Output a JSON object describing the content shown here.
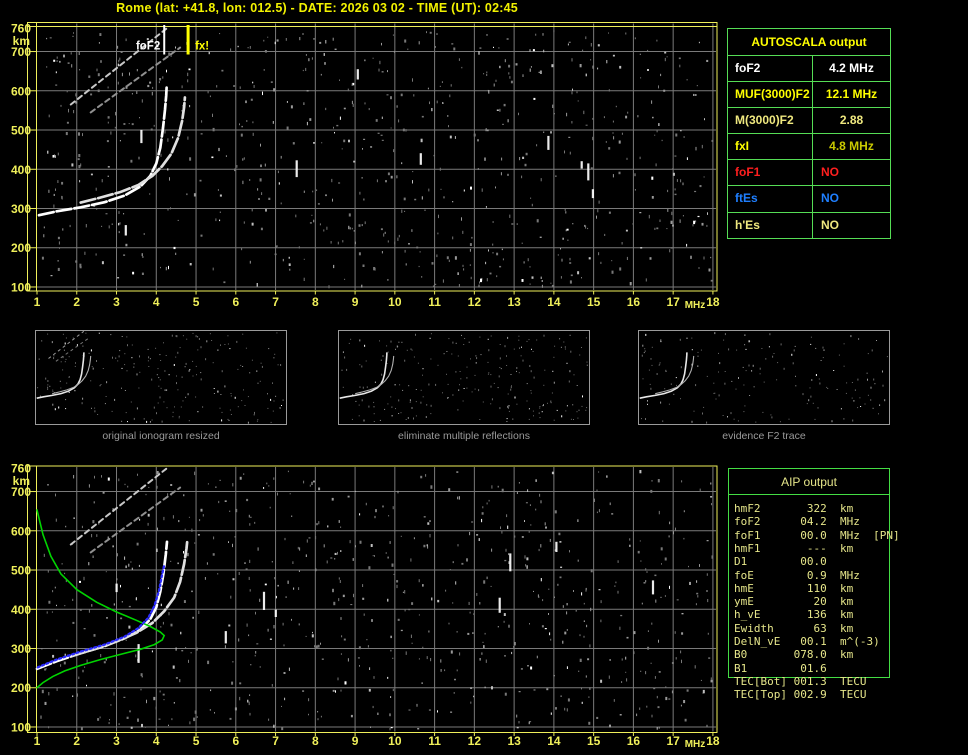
{
  "title": "Rome (lat: +41.8, lon: 012.5) - DATE: 2026 03 02 - TIME (UT): 02:45",
  "colors": {
    "background": "#000000",
    "title_yellow": "#f2f200",
    "axis_yellow": "#efef5a",
    "grid_gray": "#7a7a7a",
    "table_green": "#55dd55",
    "caption_gray": "#9a9a9a",
    "aip_text": "#e6e68a",
    "profile_green": "#00d400",
    "trace_blue": "#2b2bff",
    "marker_foF2": "#ffffff",
    "marker_fxI": "#ffff00"
  },
  "autoscala": {
    "title": "AUTOSCALA output",
    "rows": [
      {
        "label": "foF2",
        "value": "4.2 MHz",
        "color": "#ffffff"
      },
      {
        "label": "MUF(3000)F2",
        "value": "12.1 MHz",
        "color": "#ffff00"
      },
      {
        "label": "M(3000)F2",
        "value": "2.88",
        "color": "#efe87f"
      },
      {
        "label": "fxI",
        "value": "4.8 MHz",
        "color": "#ffff00",
        "value_color": "#c9c900"
      },
      {
        "label": "foF1",
        "value": "NO",
        "color": "#ff1f1f"
      },
      {
        "label": "ftEs",
        "value": "NO",
        "color": "#1f7fff"
      },
      {
        "label": "h'Es",
        "value": "NO",
        "color": "#efe87f"
      }
    ]
  },
  "aip": {
    "title": "AIP output",
    "rows": [
      {
        "label": "hmF2",
        "value": "322",
        "unit": "km"
      },
      {
        "label": "foF2",
        "value": "04.2",
        "unit": "MHz"
      },
      {
        "label": "foF1",
        "value": "00.0",
        "unit": "MHz",
        "extra": "[PN]"
      },
      {
        "label": "hmF1",
        "value": "---",
        "unit": "km"
      },
      {
        "label": "D1",
        "value": "00.0",
        "unit": ""
      },
      {
        "label": "foE",
        "value": "0.9",
        "unit": "MHz"
      },
      {
        "label": "hmE",
        "value": "110",
        "unit": "km"
      },
      {
        "label": "ymE",
        "value": "20",
        "unit": "km"
      },
      {
        "label": "h_vE",
        "value": "136",
        "unit": "km"
      },
      {
        "label": "Ewidth",
        "value": "63",
        "unit": "km"
      },
      {
        "label": "DelN_vE",
        "value": "00.1",
        "unit": "m^(-3)"
      },
      {
        "label": "B0",
        "value": "078.0",
        "unit": "km"
      },
      {
        "label": "B1",
        "value": "01.6",
        "unit": ""
      },
      {
        "label": "TEC[Bot]",
        "value": "001.3",
        "unit": "TECU"
      },
      {
        "label": "TEC[Top]",
        "value": "002.9",
        "unit": "TECU"
      }
    ]
  },
  "thumbnails": [
    {
      "caption": "original ionogram resized"
    },
    {
      "caption": "eliminate multiple reflections"
    },
    {
      "caption": "evidence F2 trace"
    }
  ],
  "noise": {
    "seed": 987654321,
    "plot_dots": 720,
    "plot_streaks": 9,
    "thumb_dots": 240,
    "thumb_dots_sparse": 175
  },
  "chart_data": [
    {
      "type": "scatter",
      "title": "scaled ionogram with autoscaled characteristics",
      "xlabel": "MHz",
      "ylabel": "km",
      "xlim": [
        1,
        18
      ],
      "ylim": [
        100,
        760
      ],
      "grid": true,
      "x_ticks": [
        1,
        2,
        3,
        4,
        5,
        6,
        7,
        8,
        9,
        10,
        11,
        12,
        13,
        14,
        15,
        16,
        17,
        18
      ],
      "y_ticks": [
        760,
        700,
        600,
        500,
        400,
        300,
        200,
        100
      ],
      "annotations": [
        {
          "label": "foF2",
          "x_mhz": 4.2,
          "color": "#ffffff"
        },
        {
          "label": "fx!",
          "x_mhz": 4.8,
          "color": "#ffff00"
        }
      ],
      "series": [
        {
          "name": "F2-trace-ordinary",
          "color": "#ffffff",
          "style": "trace",
          "points": [
            [
              1.05,
              283
            ],
            [
              1.5,
              293
            ],
            [
              2.1,
              303
            ],
            [
              2.7,
              316
            ],
            [
              3.2,
              333
            ],
            [
              3.6,
              356
            ],
            [
              3.85,
              383
            ],
            [
              4.0,
              415
            ],
            [
              4.1,
              455
            ],
            [
              4.17,
              505
            ],
            [
              4.22,
              552
            ],
            [
              4.25,
              588
            ],
            [
              4.26,
              608
            ]
          ]
        },
        {
          "name": "F2-trace-extraordinary",
          "color": "#e0e0e0",
          "style": "trace",
          "points": [
            [
              2.1,
              315
            ],
            [
              2.6,
              328
            ],
            [
              3.1,
              342
            ],
            [
              3.55,
              360
            ],
            [
              3.9,
              383
            ],
            [
              4.15,
              408
            ],
            [
              4.38,
              440
            ],
            [
              4.55,
              480
            ],
            [
              4.65,
              523
            ],
            [
              4.7,
              558
            ],
            [
              4.72,
              583
            ]
          ]
        },
        {
          "name": "second-hop-echo-1",
          "color": "#c8c8c8",
          "style": "dashed",
          "points": [
            [
              1.85,
              565
            ],
            [
              4.25,
              758
            ]
          ]
        },
        {
          "name": "second-hop-echo-2",
          "color": "#909090",
          "style": "dashed",
          "points": [
            [
              2.35,
              545
            ],
            [
              4.6,
              710
            ]
          ]
        }
      ]
    },
    {
      "type": "scatter",
      "title": "ionogram with restored electron density profile",
      "xlabel": "MHz",
      "ylabel": "km",
      "xlim": [
        1,
        18
      ],
      "ylim": [
        100,
        760
      ],
      "grid": true,
      "x_ticks": [
        1,
        2,
        3,
        4,
        5,
        6,
        7,
        8,
        9,
        10,
        11,
        12,
        13,
        14,
        15,
        16,
        17,
        18
      ],
      "y_ticks": [
        760,
        700,
        600,
        500,
        400,
        300,
        200,
        100
      ],
      "annotations": [],
      "series": [
        {
          "name": "F2-trace-ordinary",
          "color": "#ffffff",
          "style": "trace",
          "points": [
            [
              1.0,
              248
            ],
            [
              1.5,
              268
            ],
            [
              2.1,
              288
            ],
            [
              2.7,
              306
            ],
            [
              3.2,
              326
            ],
            [
              3.6,
              348
            ],
            [
              3.85,
              375
            ],
            [
              4.0,
              405
            ],
            [
              4.1,
              445
            ],
            [
              4.18,
              490
            ],
            [
              4.24,
              540
            ],
            [
              4.27,
              572
            ]
          ]
        },
        {
          "name": "F2-trace-extraordinary",
          "color": "#e0e0e0",
          "style": "trace",
          "points": [
            [
              1.9,
              282
            ],
            [
              2.5,
              300
            ],
            [
              3.0,
              318
            ],
            [
              3.5,
              340
            ],
            [
              3.9,
              365
            ],
            [
              4.2,
              395
            ],
            [
              4.45,
              430
            ],
            [
              4.6,
              470
            ],
            [
              4.7,
              515
            ],
            [
              4.76,
              555
            ],
            [
              4.78,
              575
            ]
          ]
        },
        {
          "name": "second-hop-echo-1",
          "color": "#c8c8c8",
          "style": "dashed",
          "points": [
            [
              1.85,
              565
            ],
            [
              4.25,
              758
            ]
          ]
        },
        {
          "name": "second-hop-echo-2",
          "color": "#909090",
          "style": "dashed",
          "points": [
            [
              2.35,
              545
            ],
            [
              4.6,
              710
            ]
          ]
        },
        {
          "name": "electron-density-profile",
          "color": "#00d400",
          "style": "line",
          "points": [
            [
              1.0,
              653
            ],
            [
              1.15,
              590
            ],
            [
              1.35,
              535
            ],
            [
              1.6,
              490
            ],
            [
              2.0,
              450
            ],
            [
              2.5,
              418
            ],
            [
              3.0,
              393
            ],
            [
              3.5,
              372
            ],
            [
              3.85,
              356
            ],
            [
              4.1,
              342
            ],
            [
              4.2,
              333
            ],
            [
              4.15,
              322
            ],
            [
              3.95,
              310
            ],
            [
              3.6,
              298
            ],
            [
              3.1,
              285
            ],
            [
              2.6,
              272
            ],
            [
              2.1,
              257
            ],
            [
              1.7,
              243
            ],
            [
              1.4,
              229
            ],
            [
              1.15,
              213
            ],
            [
              1.0,
              200
            ]
          ]
        },
        {
          "name": "scaled-F2-trace",
          "color": "#2b2bff",
          "style": "dotted",
          "points": [
            [
              1.02,
              252
            ],
            [
              1.5,
              272
            ],
            [
              2.1,
              292
            ],
            [
              2.7,
              310
            ],
            [
              3.2,
              330
            ],
            [
              3.55,
              352
            ],
            [
              3.8,
              378
            ],
            [
              3.95,
              408
            ],
            [
              4.07,
              448
            ],
            [
              4.15,
              490
            ],
            [
              4.2,
              512
            ]
          ]
        }
      ]
    }
  ]
}
